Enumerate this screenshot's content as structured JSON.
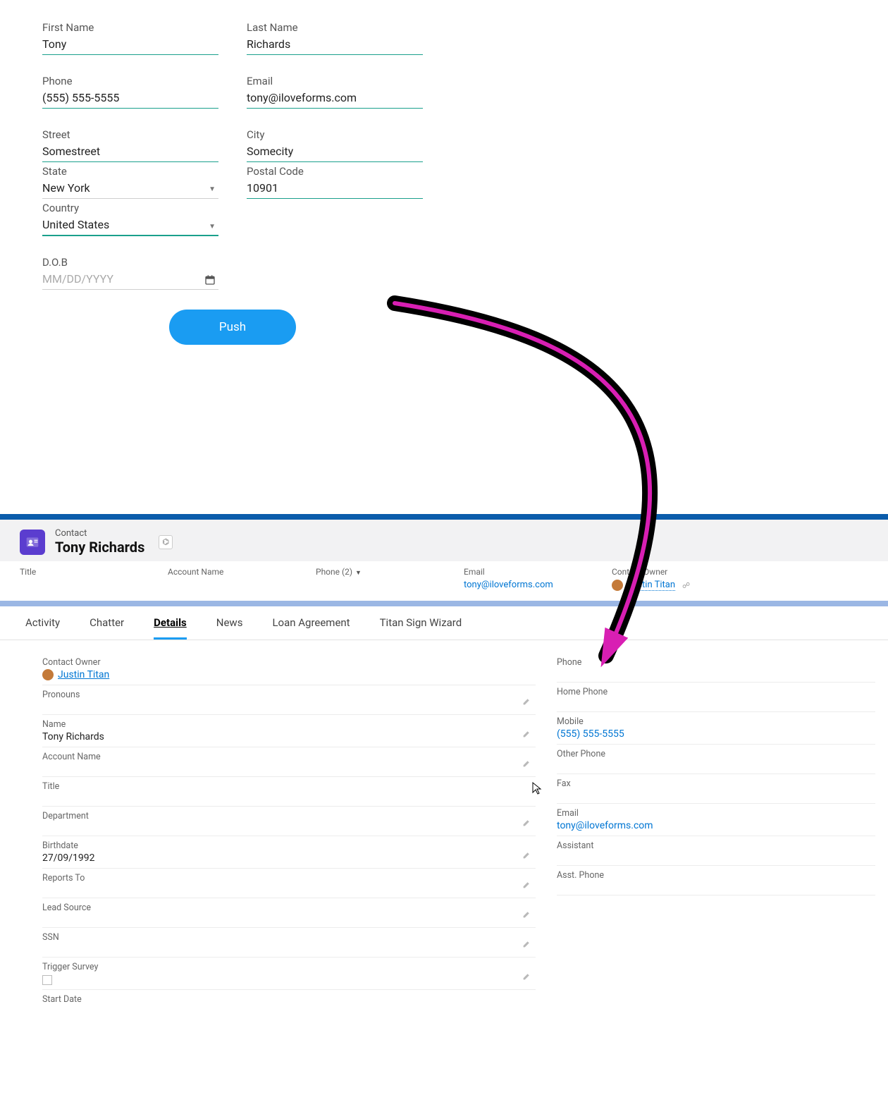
{
  "form": {
    "first_name_label": "First Name",
    "first_name_value": "Tony",
    "last_name_label": "Last Name",
    "last_name_value": "Richards",
    "phone_label": "Phone",
    "phone_value": "(555) 555-5555",
    "email_label": "Email",
    "email_value": "tony@iloveforms.com",
    "street_label": "Street",
    "street_value": "Somestreet",
    "city_label": "City",
    "city_value": "Somecity",
    "state_label": "State",
    "state_value": "New York",
    "postal_label": "Postal Code",
    "postal_value": "10901",
    "country_label": "Country",
    "country_value": "United States",
    "dob_label": "D.O.B",
    "dob_placeholder": "MM/DD/YYYY",
    "push_label": "Push"
  },
  "sf_header": {
    "object_label": "Contact",
    "record_name": "Tony Richards"
  },
  "sf_highlight": {
    "title_label": "Title",
    "account_label": "Account Name",
    "phone_label": "Phone (2)",
    "email_label": "Email",
    "email_value": "tony@iloveforms.com",
    "owner_label": "Contact Owner",
    "owner_value": "Justin Titan"
  },
  "tabs": {
    "activity": "Activity",
    "chatter": "Chatter",
    "details": "Details",
    "news": "News",
    "loan": "Loan Agreement",
    "wizard": "Titan Sign Wizard"
  },
  "details_left": {
    "owner_label": "Contact Owner",
    "owner_value": "Justin Titan",
    "pronouns_label": "Pronouns",
    "name_label": "Name",
    "name_value": "Tony Richards",
    "account_label": "Account Name",
    "title_label": "Title",
    "dept_label": "Department",
    "birth_label": "Birthdate",
    "birth_value": "27/09/1992",
    "reports_label": "Reports To",
    "lead_label": "Lead Source",
    "ssn_label": "SSN",
    "survey_label": "Trigger Survey",
    "start_label": "Start Date"
  },
  "details_right": {
    "phone_label": "Phone",
    "home_label": "Home Phone",
    "mobile_label": "Mobile",
    "mobile_value": "(555) 555-5555",
    "other_label": "Other Phone",
    "fax_label": "Fax",
    "email_label": "Email",
    "email_value": "tony@iloveforms.com",
    "assistant_label": "Assistant",
    "asst_phone_label": "Asst. Phone"
  }
}
